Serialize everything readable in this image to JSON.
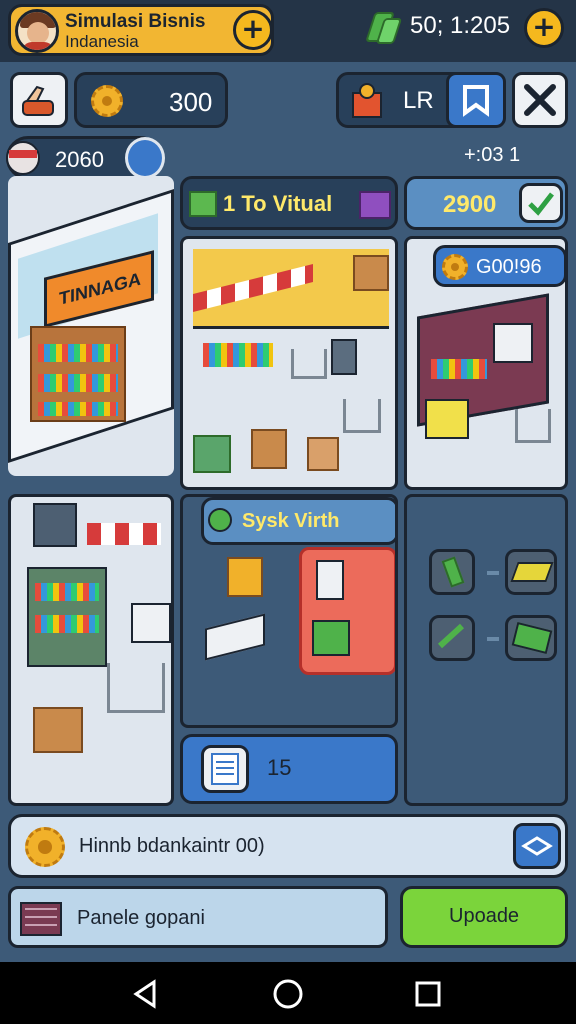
{
  "header": {
    "title_line1": "Simulasi Bisnis",
    "title_line2": "Indanesia",
    "add_symbol": "+",
    "currency": "50; 1:205",
    "currency_add_symbol": "+"
  },
  "toolbar": {
    "coin_value": "300",
    "level_label": "LR",
    "balance_value": "2060",
    "timer_text": "+:03 1"
  },
  "panels": {
    "virtual_label": "1 To Vitual",
    "virtual_value": "2900",
    "gear_value": "G00!96",
    "store_sign": "TINNAGA",
    "sysk_label": "Sysk Virth",
    "count_value": "15",
    "info_text": "Hinnb bdankaintr 00)",
    "panel_label": "Panele gopani",
    "upgrade_label": "Upoade"
  },
  "colors": {
    "accent_orange": "#f2b632",
    "upgrade_green": "#7bd43b",
    "panel_blue": "#3d5a78",
    "highlight_red": "#ec6b5b"
  },
  "icons": [
    "avatar",
    "plus-icon",
    "gem-icon",
    "hand-icon",
    "gear-icon",
    "gift-icon",
    "bookmark-icon",
    "tools-icon",
    "flag-icon",
    "check-icon",
    "list-icon",
    "layers-icon",
    "chest-icon"
  ]
}
